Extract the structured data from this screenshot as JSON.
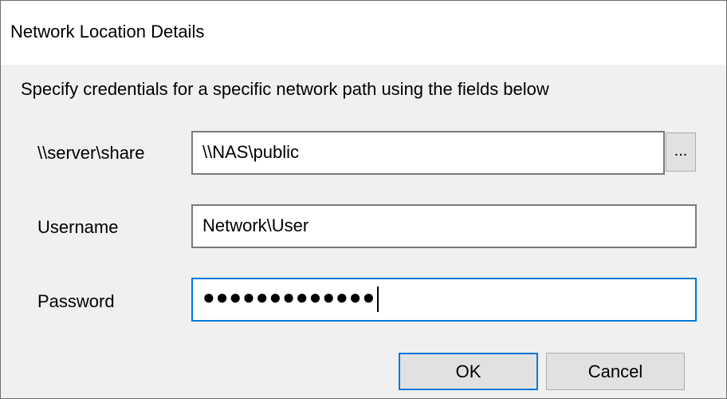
{
  "window": {
    "title": "Network Location Details"
  },
  "dialog": {
    "instructions": "Specify credentials for a specific network path using the fields below",
    "path": {
      "label": "\\\\server\\share",
      "value": "\\\\NAS\\public",
      "browse_label": "..."
    },
    "username": {
      "label": "Username",
      "value": "Network\\User"
    },
    "password": {
      "label": "Password",
      "masked_value": "●●●●●●●●●●●●●"
    },
    "buttons": {
      "ok_label": "OK",
      "cancel_label": "Cancel"
    }
  },
  "colors": {
    "focus_accent": "#0078d7",
    "dialog_background": "#f0f0f0",
    "titlebar_background": "#ffffff"
  }
}
